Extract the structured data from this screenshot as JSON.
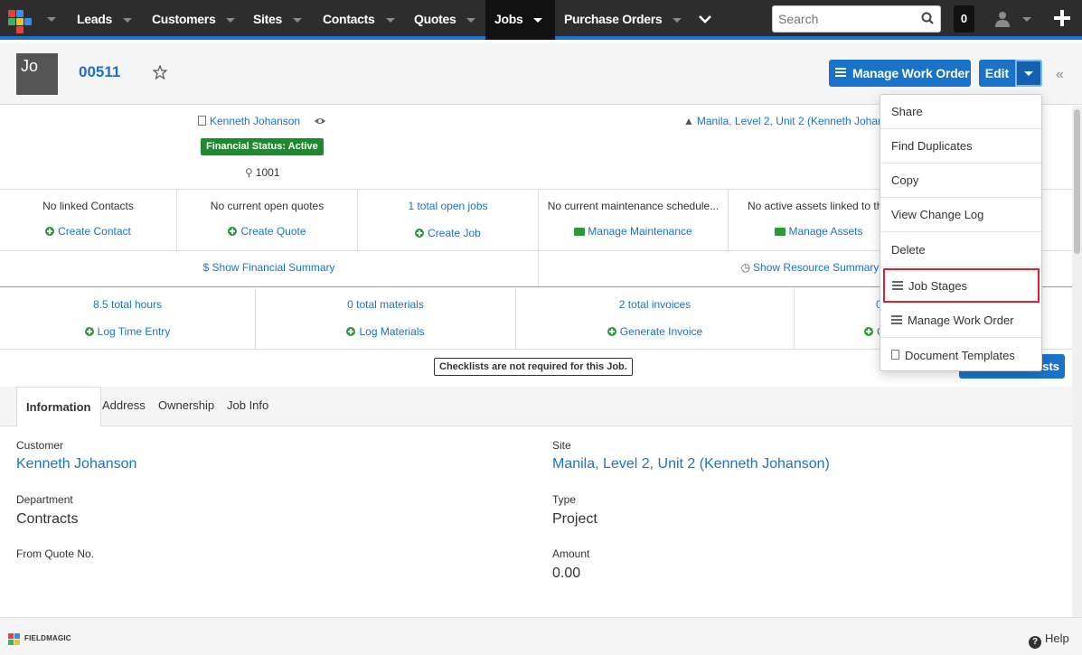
{
  "colors": {
    "accent": "#1a73c9",
    "nav_bg": "#2d2d2d",
    "status_green": "#1e8a2e",
    "highlight_red": "#d9232e"
  },
  "nav": {
    "items": [
      "Leads",
      "Customers",
      "Sites",
      "Contacts",
      "Quotes",
      "Jobs",
      "Purchase Orders"
    ],
    "active": "Jobs",
    "search_placeholder": "Search",
    "badge_count": "0"
  },
  "header": {
    "avatar_initials": "Jo",
    "record_number": "00511",
    "manage_work_order_label": "Manage Work Order",
    "edit_label": "Edit"
  },
  "summary": {
    "customer": "Kenneth Johanson",
    "financial_status": "Financial Status: Active",
    "site_number": "1001",
    "site": "Manila, Level 2, Unit 2 (Kenneth Johanson)"
  },
  "related_row": [
    {
      "line1": "No linked Contacts",
      "line2": "Create Contact",
      "icon": "plus-circle-icon"
    },
    {
      "line1": "No current open quotes",
      "line2": "Create Quote",
      "icon": "plus-circle-icon"
    },
    {
      "line1": "1 total open jobs",
      "line2": "Create Job",
      "icon": "plus-circle-icon"
    },
    {
      "line1": "No current maintenance schedule...",
      "line2": "Manage Maintenance",
      "icon": "briefcase-icon"
    },
    {
      "line1": "No active assets linked to this",
      "line2": "Manage Assets",
      "icon": "briefcase-icon"
    }
  ],
  "summary_links": {
    "financial": "$ Show Financial Summary",
    "resource": "Show Resource Summary"
  },
  "stats_row": [
    {
      "line1": "8.5 total hours",
      "line2": "Log Time Entry"
    },
    {
      "line1": "0 total materials",
      "line2": "Log Materials"
    },
    {
      "line1": "2 total invoices",
      "line2": "Generate Invoice"
    },
    {
      "line1": "0",
      "line2": "C"
    }
  ],
  "checklist_message": "Checklists are not required for this Job.",
  "checklists_button": "lists",
  "tabs": [
    "Information",
    "Address",
    "Ownership",
    "Job Info"
  ],
  "fields": {
    "customer_label": "Customer",
    "customer_value": "Kenneth Johanson",
    "site_label": "Site",
    "site_value": "Manila, Level 2, Unit 2 (Kenneth Johanson)",
    "department_label": "Department",
    "department_value": "Contracts",
    "type_label": "Type",
    "type_value": "Project",
    "from_quote_label": "From Quote No.",
    "amount_label": "Amount",
    "amount_value": "0.00"
  },
  "dropdown": {
    "items": [
      "Share",
      "Find Duplicates",
      "Copy",
      "View Change Log",
      "Delete",
      "Job Stages",
      "Manage Work Order",
      "Document Templates"
    ],
    "highlighted": "Job Stages"
  },
  "footer": {
    "brand": "FIELDMAGIC",
    "help": "Help"
  }
}
